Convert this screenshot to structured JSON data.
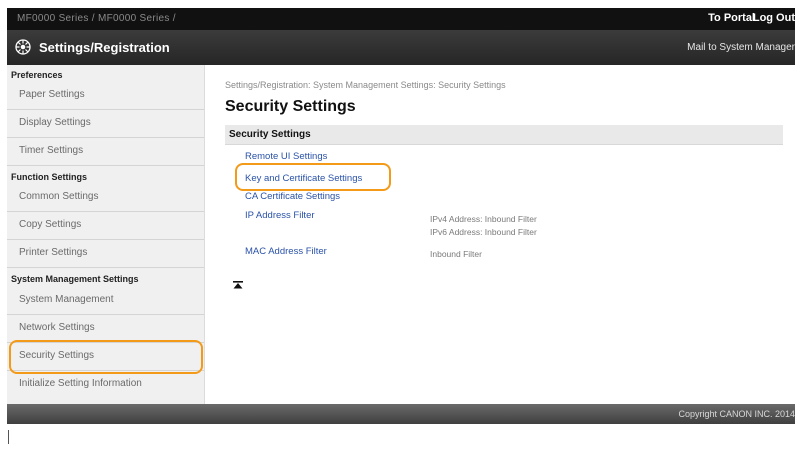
{
  "topbar": {
    "model": "MF0000 Series / MF0000 Series /",
    "to_portal": "To Portal",
    "log_out": "Log Out"
  },
  "header": {
    "icon": "settings-gear-icon",
    "title": "Settings/Registration",
    "mail": "Mail to System Manager"
  },
  "sidebar": {
    "sections": [
      {
        "heading": "Preferences",
        "items": [
          "Paper Settings",
          "Display Settings",
          "Timer Settings"
        ]
      },
      {
        "heading": "Function Settings",
        "items": [
          "Common Settings",
          "Copy Settings",
          "Printer Settings"
        ]
      },
      {
        "heading": "System Management Settings",
        "items": [
          "System Management",
          "Network Settings",
          "Security Settings",
          "Initialize Setting Information"
        ]
      }
    ]
  },
  "main": {
    "breadcrumb": "Settings/Registration: System Management Settings: Security Settings",
    "title": "Security Settings",
    "section_title": "Security Settings",
    "links": [
      {
        "label": "Remote UI Settings"
      },
      {
        "label": "Key and Certificate Settings"
      },
      {
        "label": "CA Certificate Settings"
      },
      {
        "label": "IP Address Filter",
        "desc": [
          "IPv4 Address: Inbound Filter",
          "IPv6 Address: Inbound Filter"
        ]
      },
      {
        "label": "MAC Address Filter",
        "desc": [
          "Inbound Filter"
        ]
      }
    ],
    "back_to_top_icon": "back-to-top-icon"
  },
  "footer": {
    "copyright": "Copyright CANON INC. 2014"
  },
  "highlight_color": "#f39a18"
}
